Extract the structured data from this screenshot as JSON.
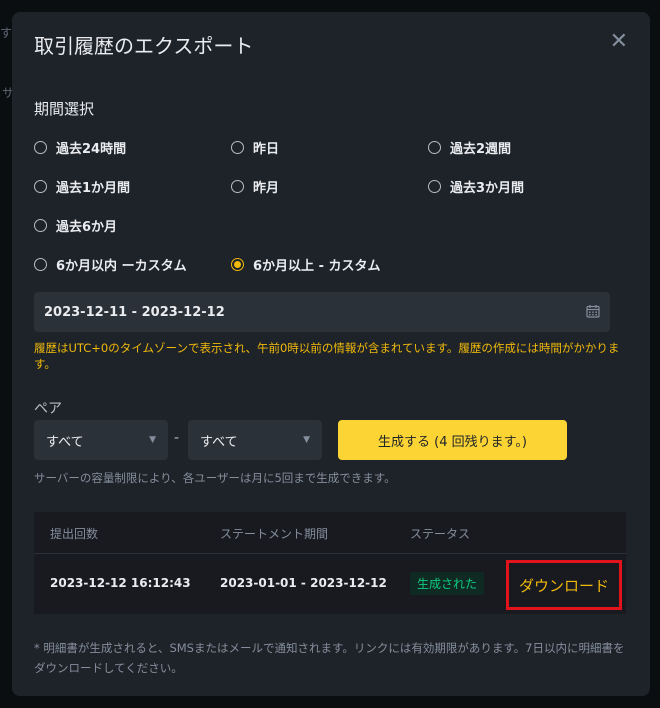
{
  "backdrop": {
    "fragment_1": "す",
    "fragment_2": "サ"
  },
  "modal": {
    "title": "取引履歴のエクスポート",
    "close_symbol": "✕"
  },
  "period": {
    "label": "期間選択",
    "options": [
      {
        "label": "過去24時間",
        "checked": false
      },
      {
        "label": "昨日",
        "checked": false
      },
      {
        "label": "過去2週間",
        "checked": false
      },
      {
        "label": "過去1か月間",
        "checked": false
      },
      {
        "label": "昨月",
        "checked": false
      },
      {
        "label": "過去3か月間",
        "checked": false
      },
      {
        "label": "過去6か月",
        "checked": false
      },
      {
        "label": "6か月以内 ーカスタム",
        "checked": false
      },
      {
        "label": "6か月以上 - カスタム",
        "checked": true
      }
    ],
    "date_range": "2023-12-11 - 2023-12-12",
    "date_icon": "calendar-icon",
    "warning": "履歴はUTC+0のタイムゾーンで表示され、午前0時以前の情報が含まれています。履歴の作成には時間がかかります。"
  },
  "pair": {
    "label": "ペア",
    "base_value": "すべて",
    "quote_value": "すべて",
    "separator": "-"
  },
  "generate_button": "生成する (4 回残ります。)",
  "limit_note": "サーバーの容量制限により、各ユーザーは月に5回まで生成できます。",
  "table": {
    "headers": [
      "提出回数",
      "ステートメント期間",
      "ステータス"
    ],
    "rows": [
      {
        "submitted": "2023-12-12 16:12:43",
        "period": "2023-01-01 - 2023-12-12",
        "status": "生成された",
        "action": "ダウンロード"
      }
    ]
  },
  "footer_note": "* 明細書が生成されると、SMSまたはメールで通知されます。リンクには有効期限があります。7日以内に明細書をダウンロードしてください。",
  "colors": {
    "accent": "#fcd535",
    "warning_text": "#f0b90b",
    "success": "#0ecb81",
    "highlight_border": "#e3131b",
    "modal_bg": "#1e2329"
  }
}
